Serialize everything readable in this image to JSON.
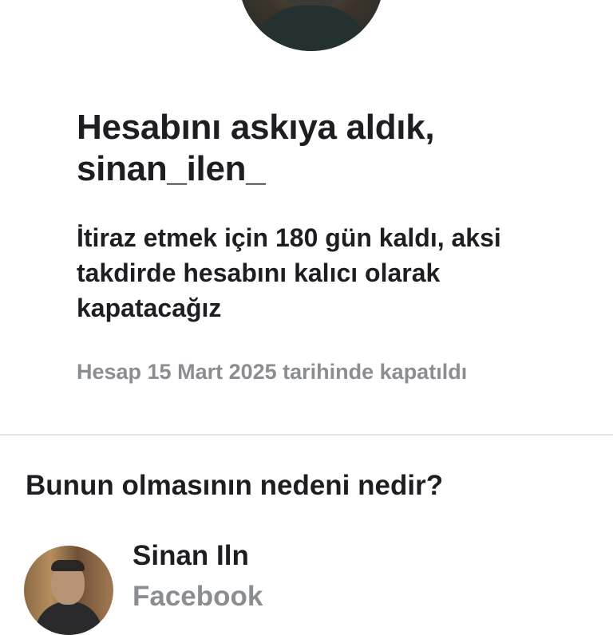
{
  "header": {
    "title": "Hesabını askıya aldık, sinan_ilen_",
    "subtitle": "İtiraz etmek için 180 gün kaldı, aksi takdirde hesabını kalıcı olarak kapatacağız",
    "closed_note": "Hesap 15 Mart 2025 tarihinde kapatıldı"
  },
  "reason_section": {
    "title": "Bunun olmasının nedeni nedir?"
  },
  "account": {
    "name": "Sinan Iln",
    "platform": "Facebook"
  },
  "colors": {
    "primary_text": "#1c1e21",
    "secondary_text": "#8a8d91",
    "divider": "#e4e6eb",
    "background": "#ffffff"
  }
}
